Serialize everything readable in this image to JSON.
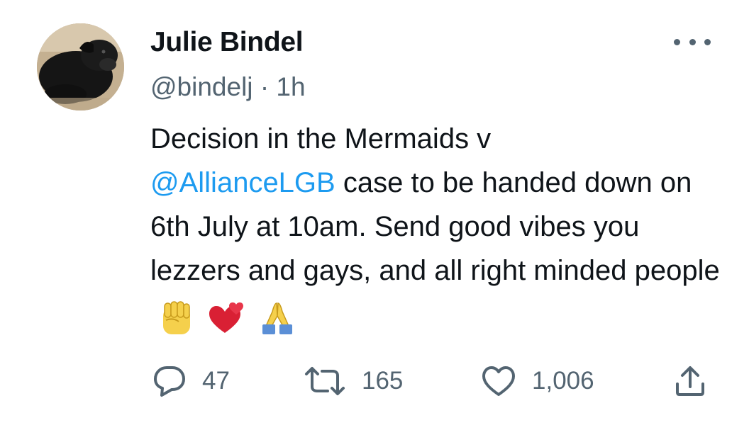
{
  "tweet": {
    "author": {
      "name": "Julie Bindel",
      "handle": "@bindelj",
      "separator": "·",
      "time": "1h"
    },
    "text": {
      "part1": "Decision in the Mermaids v",
      "mention": "@AllianceLGB",
      "part2": " case to be handed down on 6th July at 10am. Send good vibes you lezzers and gays, and all right minded people"
    },
    "emojis": [
      "raised-fist",
      "two-hearts",
      "folded-hands"
    ],
    "metrics": {
      "replies": "47",
      "retweets": "165",
      "likes": "1,006"
    }
  },
  "colors": {
    "text_primary": "#0f1419",
    "text_secondary": "#536471",
    "link": "#1d9bf0"
  },
  "icons": {
    "reply": "speech-bubble-icon",
    "retweet": "retweet-arrows-icon",
    "like": "heart-outline-icon",
    "share": "share-upload-icon",
    "more": "ellipsis-icon"
  }
}
